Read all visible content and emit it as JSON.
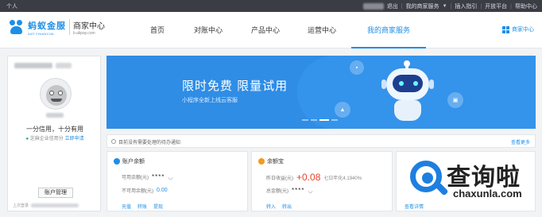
{
  "topbar": {
    "left": "个人",
    "links": [
      "退出",
      "我的商家服务",
      "插入指引",
      "开放平台",
      "帮助中心"
    ]
  },
  "header": {
    "brand_name": "蚂蚁金服",
    "brand_en": "ANT FINANCIAL",
    "center_name": "商家中心",
    "center_url": "b.alipay.com",
    "nav": [
      {
        "label": "首页",
        "active": false
      },
      {
        "label": "对账中心",
        "active": false
      },
      {
        "label": "产品中心",
        "active": false
      },
      {
        "label": "运营中心",
        "active": false
      },
      {
        "label": "我的商家服务",
        "active": true
      }
    ],
    "right_label": "商家中心"
  },
  "profile": {
    "credit": "一分信用，十分有用",
    "cert_ok": "已",
    "cert_text": "芝麻企业信用分",
    "cert_apply": "立即申请",
    "account_button": "账户管理",
    "last_login_label": "上次登录"
  },
  "banner": {
    "title": "限时免费 限量试用",
    "subtitle": "小程序全新上线云客服"
  },
  "notice": {
    "text": "目前没有需要处理的待办通知",
    "more": "查看更多"
  },
  "balance_card": {
    "title": "账户余额",
    "available_label": "可用余额(元)",
    "available_value": "****",
    "unavailable_label": "不可用余额(元)",
    "unavailable_value": "0.00",
    "links": [
      "充值",
      "转账",
      "提现"
    ]
  },
  "yuebao_card": {
    "title": "余额宝",
    "yesterday_label": "昨日收益(元)",
    "yesterday_value": "+0.08",
    "rate": "七日年化4.1940%",
    "total_label": "总金额(元)",
    "total_value": "****",
    "links": [
      "转入",
      "转出"
    ]
  },
  "third_card": {
    "link": "查看详情"
  },
  "watermark": {
    "name": "查询啦",
    "url": "chaxunla.com"
  },
  "colors": {
    "accent": "#1e8fe6",
    "topbar": "#3b3d45",
    "banner": "#2f8de6",
    "gain": "#e8432a"
  }
}
